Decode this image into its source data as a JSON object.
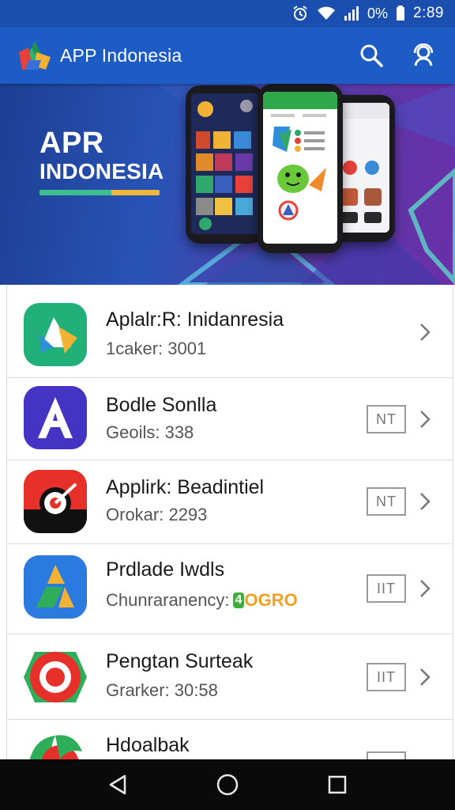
{
  "status_bar": {
    "battery_percent": "0%",
    "time": "2:89"
  },
  "app_bar": {
    "title": "APP Indonesia",
    "actions": [
      "search-icon",
      "account-icon"
    ]
  },
  "banner": {
    "title_line1": "APR",
    "title_line2": "INDONESIA"
  },
  "apps": [
    {
      "name": "Aplalr:R: Inidanresia",
      "meta": "1caker: 3001",
      "icon": "green-arrow-logo",
      "has_tag": false,
      "tag": ""
    },
    {
      "name": "Bodle Sonlla",
      "meta": "Geoils: 338",
      "icon": "letter-a-logo",
      "has_tag": true,
      "tag": "NT"
    },
    {
      "name": "Applirk: Beadintiel",
      "meta": "Orokar: 2293",
      "icon": "target-logo",
      "has_tag": true,
      "tag": "NT"
    },
    {
      "name": "Prdlade Iwdls",
      "meta": "Chunraranency:",
      "meta_badge": "4",
      "meta_badge_text": "OGRO",
      "icon": "triangle-a-logo",
      "has_tag": true,
      "tag": "IIT"
    },
    {
      "name": "Pengtan Surteak",
      "meta": "Grarker: 30:58",
      "icon": "ring-logo",
      "has_tag": true,
      "tag": "IIT"
    },
    {
      "name": "Hdoalbak",
      "meta": "",
      "icon": "leaf-logo",
      "has_tag": true,
      "tag": ""
    }
  ],
  "colors": {
    "app_bar": "#1c5cc4",
    "status_bar": "#1a4fb0",
    "accent_green": "#3fbf8f",
    "accent_yellow": "#f0b73a"
  }
}
